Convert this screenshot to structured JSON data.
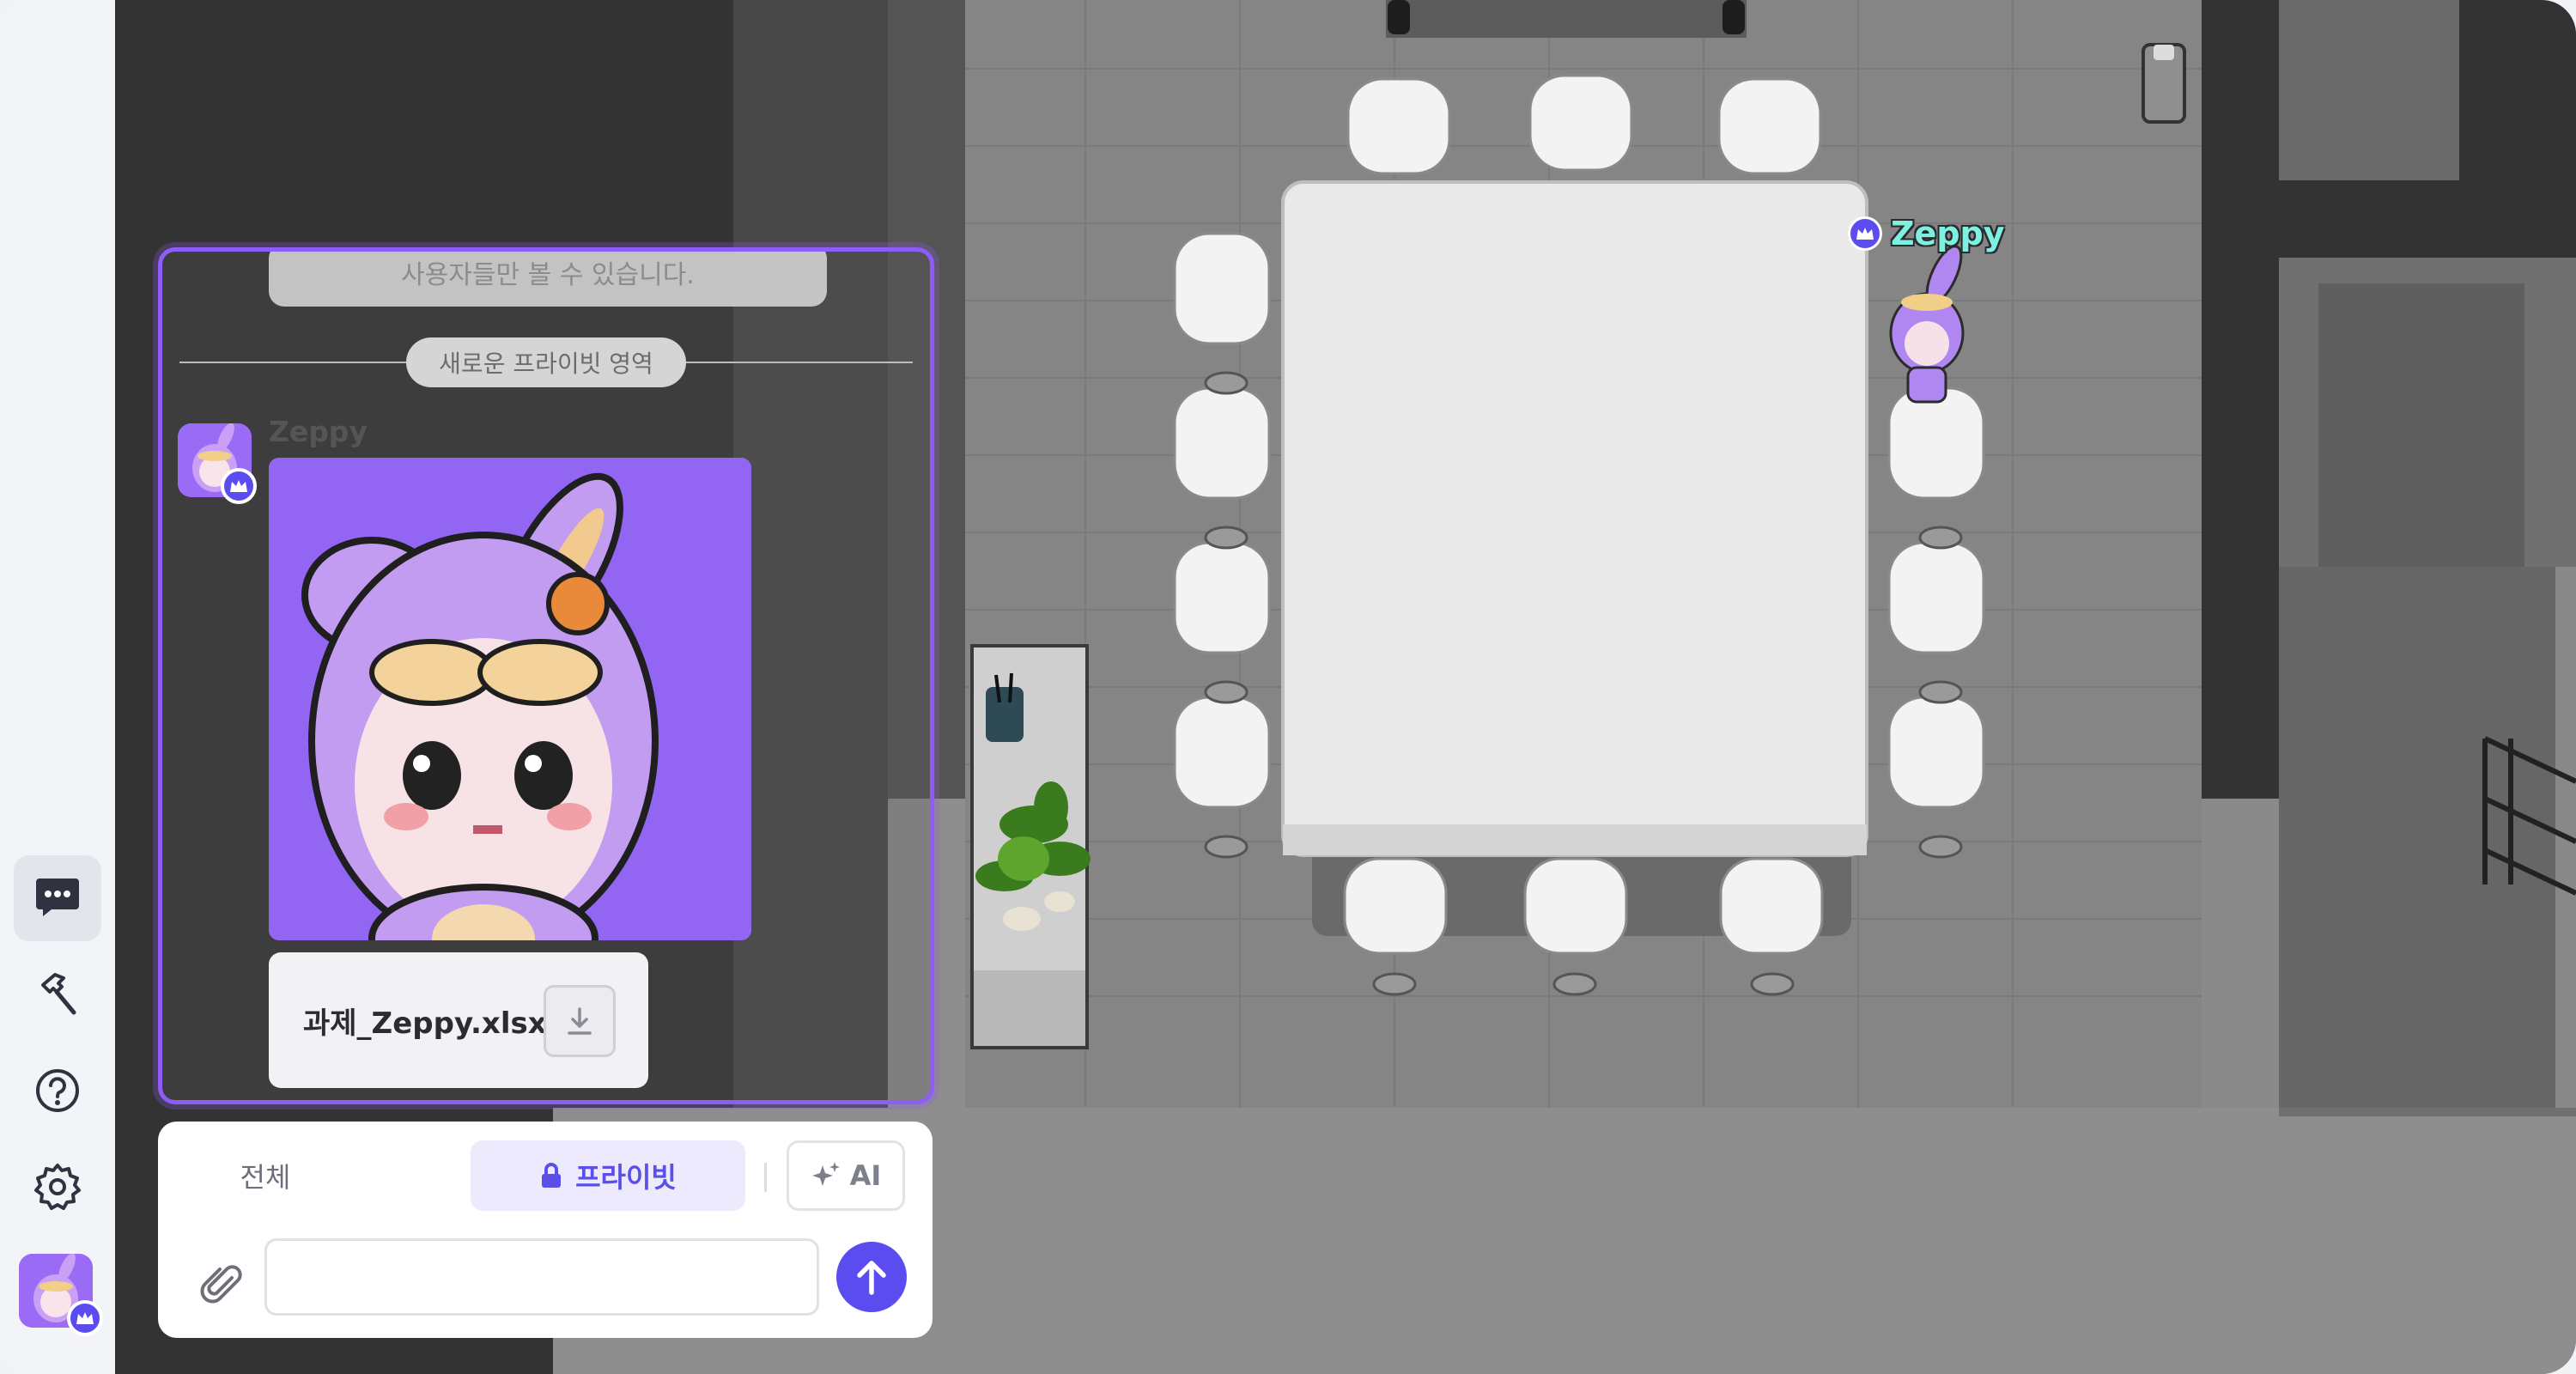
{
  "rail": {
    "items": [
      {
        "name": "chat",
        "icon": "chat-bubble-icon",
        "active": true
      },
      {
        "name": "build",
        "icon": "hammer-icon",
        "active": false
      },
      {
        "name": "help",
        "icon": "help-circle-icon",
        "active": false
      },
      {
        "name": "settings",
        "icon": "gear-icon",
        "active": false
      }
    ],
    "profile_icon": "user-avatar"
  },
  "chat": {
    "notice_text": "사용자들만 볼 수 있습니다.",
    "divider_label": "새로운 프라이빗 영역",
    "message": {
      "sender": "Zeppy",
      "attachment_image": "zeppy-avatar-image",
      "file_name": "과제_Zeppy.xlsx"
    }
  },
  "composer": {
    "tab_all": "전체",
    "tab_private": "프라이빗",
    "tab_ai": "AI",
    "input_value": "",
    "input_placeholder": ""
  },
  "map": {
    "character_name": "Zeppy"
  },
  "colors": {
    "accent": "#5b4cf0",
    "panel_border": "#8e5cf6",
    "avatar_bg": "#9a6bf5",
    "name_tag": "#7ef0e2"
  }
}
